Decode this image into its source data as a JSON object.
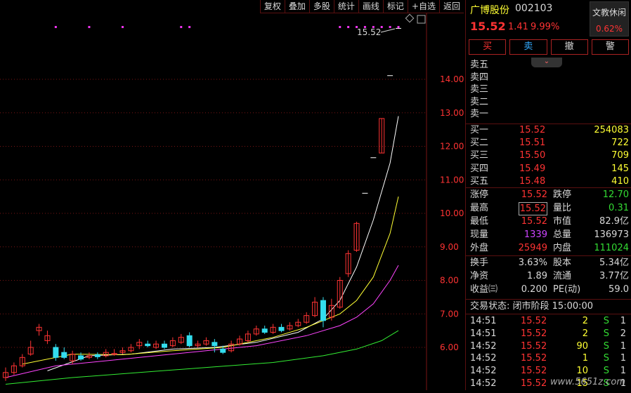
{
  "toolbar": {
    "items": [
      "复权",
      "叠加",
      "多股",
      "统计",
      "画线",
      "标记",
      "+自选",
      "返回"
    ]
  },
  "chart": {
    "price_labels": [
      "14.00",
      "13.00",
      "12.00",
      "11.00",
      "10.00",
      "9.00",
      "8.00",
      "7.00",
      "6.00"
    ],
    "high_annotation": "15.52"
  },
  "header": {
    "name": "广博股份",
    "code": "002103",
    "price": "15.52",
    "change": "1.41",
    "change_pct": "9.99%",
    "sector_name": "文教休闲",
    "sector_pct": "0.62%"
  },
  "actions": {
    "buy": "买",
    "sell": "卖",
    "cancel": "撤",
    "alert": "警"
  },
  "asks": [
    {
      "label": "卖五",
      "price": "",
      "vol": ""
    },
    {
      "label": "卖四",
      "price": "",
      "vol": ""
    },
    {
      "label": "卖三",
      "price": "",
      "vol": ""
    },
    {
      "label": "卖二",
      "price": "",
      "vol": ""
    },
    {
      "label": "卖一",
      "price": "",
      "vol": ""
    }
  ],
  "bids": [
    {
      "label": "买一",
      "price": "15.52",
      "vol": "254083"
    },
    {
      "label": "买二",
      "price": "15.51",
      "vol": "722"
    },
    {
      "label": "买三",
      "price": "15.50",
      "vol": "709"
    },
    {
      "label": "买四",
      "price": "15.49",
      "vol": "145"
    },
    {
      "label": "买五",
      "price": "15.48",
      "vol": "410"
    }
  ],
  "stats": [
    {
      "l1": "涨停",
      "v1": "15.52",
      "l2": "跌停",
      "v2": "12.70"
    },
    {
      "l1": "最高",
      "v1": "15.52",
      "l2": "量比",
      "v2": "0.31"
    },
    {
      "l1": "最低",
      "v1": "15.52",
      "l2": "市值",
      "v2": "82.9亿"
    },
    {
      "l1": "现量",
      "v1": "1339",
      "l2": "总量",
      "v2": "136973"
    },
    {
      "l1": "外盘",
      "v1": "25949",
      "l2": "内盘",
      "v2": "111024"
    }
  ],
  "fund": [
    {
      "l1": "换手",
      "v1": "3.63%",
      "l2": "股本",
      "v2": "5.34亿"
    },
    {
      "l1": "净资",
      "v1": "1.89",
      "l2": "流通",
      "v2": "3.77亿"
    },
    {
      "l1": "收益㈢",
      "v1": "0.200",
      "l2": "PE(动)",
      "v2": "59.0"
    }
  ],
  "status": "交易状态: 闭市阶段 15:00:00",
  "ticks": [
    {
      "t": "14:51",
      "p": "15.52",
      "v": "2",
      "s": "S",
      "n": "1"
    },
    {
      "t": "14:51",
      "p": "15.52",
      "v": "2",
      "s": "S",
      "n": "2"
    },
    {
      "t": "14:52",
      "p": "15.52",
      "v": "90",
      "s": "S",
      "n": "1"
    },
    {
      "t": "14:52",
      "p": "15.52",
      "v": "1",
      "s": "S",
      "n": "1"
    },
    {
      "t": "14:52",
      "p": "15.52",
      "v": "10",
      "s": "S",
      "n": "1"
    },
    {
      "t": "14:52",
      "p": "15.52",
      "v": "15",
      "s": "S",
      "n": "1"
    }
  ],
  "watermark": "www.5651z.com",
  "chart_data": {
    "type": "candlestick",
    "y_range": [
      5.0,
      16.0
    ],
    "candles": [
      [
        5.1,
        5.25,
        5.4,
        5.0
      ],
      [
        5.25,
        5.45,
        5.55,
        5.18
      ],
      [
        5.45,
        5.7,
        5.8,
        5.4
      ],
      [
        5.8,
        6.0,
        6.2,
        5.75
      ],
      [
        6.5,
        6.6,
        6.7,
        6.35
      ],
      [
        6.2,
        6.35,
        6.5,
        6.1
      ],
      [
        6.0,
        5.7,
        6.1,
        5.6
      ],
      [
        5.85,
        5.7,
        6.0,
        5.65
      ],
      [
        5.6,
        5.8,
        5.9,
        5.5
      ],
      [
        5.75,
        5.65,
        5.85,
        5.6
      ],
      [
        5.7,
        5.75,
        5.85,
        5.65
      ],
      [
        5.78,
        5.72,
        5.85,
        5.65
      ],
      [
        5.75,
        5.85,
        5.95,
        5.7
      ],
      [
        5.8,
        5.82,
        5.95,
        5.75
      ],
      [
        5.85,
        5.9,
        6.0,
        5.8
      ],
      [
        5.9,
        6.0,
        6.1,
        5.85
      ],
      [
        6.05,
        6.15,
        6.25,
        5.95
      ],
      [
        6.1,
        6.05,
        6.2,
        6.0
      ],
      [
        6.0,
        6.1,
        6.2,
        5.95
      ],
      [
        6.1,
        6.0,
        6.2,
        5.95
      ],
      [
        6.05,
        6.2,
        6.3,
        6.0
      ],
      [
        6.15,
        6.3,
        6.4,
        6.1
      ],
      [
        6.35,
        6.05,
        6.45,
        6.0
      ],
      [
        6.05,
        6.1,
        6.2,
        6.0
      ],
      [
        6.1,
        6.2,
        6.3,
        6.05
      ],
      [
        6.15,
        6.05,
        6.25,
        5.85
      ],
      [
        5.95,
        5.85,
        6.05,
        5.8
      ],
      [
        5.9,
        6.1,
        6.2,
        5.85
      ],
      [
        6.1,
        6.25,
        6.35,
        6.05
      ],
      [
        6.2,
        6.4,
        6.5,
        6.15
      ],
      [
        6.4,
        6.55,
        6.65,
        6.35
      ],
      [
        6.55,
        6.45,
        6.65,
        6.4
      ],
      [
        6.45,
        6.6,
        6.7,
        6.4
      ],
      [
        6.6,
        6.5,
        6.7,
        6.45
      ],
      [
        6.55,
        6.65,
        6.75,
        6.5
      ],
      [
        6.65,
        6.75,
        6.85,
        6.6
      ],
      [
        6.75,
        6.95,
        7.05,
        6.7
      ],
      [
        6.95,
        7.35,
        7.5,
        6.9
      ],
      [
        7.4,
        6.8,
        7.5,
        6.6
      ],
      [
        6.9,
        7.25,
        7.45,
        6.8
      ],
      [
        7.2,
        8.0,
        8.1,
        7.15
      ],
      [
        8.2,
        8.8,
        8.9,
        8.1
      ],
      [
        8.9,
        9.7,
        9.75,
        8.85
      ],
      [
        10.6,
        10.6,
        10.6,
        10.6
      ],
      [
        11.66,
        11.66,
        11.66,
        11.66
      ],
      [
        11.8,
        12.83,
        12.83,
        11.8
      ],
      [
        14.11,
        14.11,
        14.11,
        14.11
      ],
      [
        15.52,
        15.52,
        15.52,
        15.52
      ]
    ],
    "ma_series": [
      {
        "color": "#ffffff",
        "points": [
          [
            5,
            5.3
          ],
          [
            10,
            5.75
          ],
          [
            15,
            5.8
          ],
          [
            20,
            5.95
          ],
          [
            25,
            6.0
          ],
          [
            30,
            6.15
          ],
          [
            35,
            6.45
          ],
          [
            38,
            6.85
          ],
          [
            40,
            7.4
          ],
          [
            42,
            8.4
          ],
          [
            44,
            9.8
          ],
          [
            46,
            11.5
          ],
          [
            47,
            12.9
          ]
        ]
      },
      {
        "color": "#ffff33",
        "points": [
          [
            2,
            5.5
          ],
          [
            8,
            5.8
          ],
          [
            14,
            5.78
          ],
          [
            20,
            5.9
          ],
          [
            26,
            6.0
          ],
          [
            32,
            6.3
          ],
          [
            36,
            6.6
          ],
          [
            40,
            7.0
          ],
          [
            42,
            7.4
          ],
          [
            44,
            8.1
          ],
          [
            46,
            9.4
          ],
          [
            47,
            10.5
          ]
        ]
      },
      {
        "color": "#ff44ff",
        "points": [
          [
            0,
            5.1
          ],
          [
            6,
            5.45
          ],
          [
            12,
            5.6
          ],
          [
            18,
            5.75
          ],
          [
            24,
            5.9
          ],
          [
            30,
            6.05
          ],
          [
            36,
            6.35
          ],
          [
            40,
            6.65
          ],
          [
            42,
            6.9
          ],
          [
            44,
            7.3
          ],
          [
            46,
            8.0
          ],
          [
            47,
            8.45
          ]
        ]
      },
      {
        "color": "#33ee33",
        "points": [
          [
            0,
            4.9
          ],
          [
            8,
            5.1
          ],
          [
            16,
            5.25
          ],
          [
            24,
            5.4
          ],
          [
            32,
            5.55
          ],
          [
            38,
            5.75
          ],
          [
            42,
            5.95
          ],
          [
            45,
            6.2
          ],
          [
            47,
            6.5
          ]
        ]
      }
    ],
    "markers_pink": [
      6,
      10,
      14,
      21,
      22,
      40,
      41,
      42,
      43,
      44,
      45,
      46,
      47
    ]
  }
}
